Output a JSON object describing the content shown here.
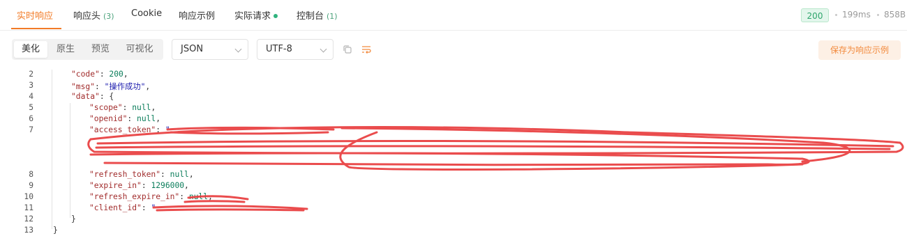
{
  "tabs": [
    {
      "label": "实时响应",
      "count": ""
    },
    {
      "label": "响应头",
      "count": "(3)"
    },
    {
      "label": "Cookie",
      "count": ""
    },
    {
      "label": "响应示例",
      "count": ""
    },
    {
      "label": "实际请求",
      "count": ""
    },
    {
      "label": "控制台",
      "count": "(1)"
    }
  ],
  "status": {
    "code": "200",
    "time": "199ms",
    "size": "858B"
  },
  "view_modes": [
    "美化",
    "原生",
    "预览",
    "可视化"
  ],
  "format_select": "JSON",
  "encoding_select": "UTF-8",
  "save_label": "保存为响应示例",
  "colors": {
    "accent": "#f27b27",
    "success": "#2fb37e",
    "redact": "#e8393a"
  },
  "icons": [
    "copy-icon",
    "wrap-lines-icon",
    "chevron-down-icon",
    "status-dot-icon"
  ],
  "code": {
    "line_numbers": [
      "2",
      "3",
      "4",
      "5",
      "6",
      "7",
      "8",
      "9",
      "10",
      "11",
      "12",
      "13"
    ],
    "code_key": "\"code\"",
    "code_val": "200",
    "msg_key": "\"msg\"",
    "msg_val": "\"操作成功\"",
    "data_key": "\"data\"",
    "scope_key": "\"scope\"",
    "scope_val": "null",
    "openid_key": "\"openid\"",
    "openid_val": "null",
    "access_token_key": "\"access_token\"",
    "access_token_val": "\"",
    "refresh_token_key": "\"refresh_token\"",
    "refresh_token_val": "null",
    "expire_in_key": "\"expire_in\"",
    "expire_in_val": "1296000",
    "refresh_expire_in_key": "\"refresh_expire_in\"",
    "refresh_expire_in_val": "null",
    "client_id_key": "\"client_id\"",
    "client_id_val": "\"",
    "close_data": "}",
    "close_root": "}"
  }
}
